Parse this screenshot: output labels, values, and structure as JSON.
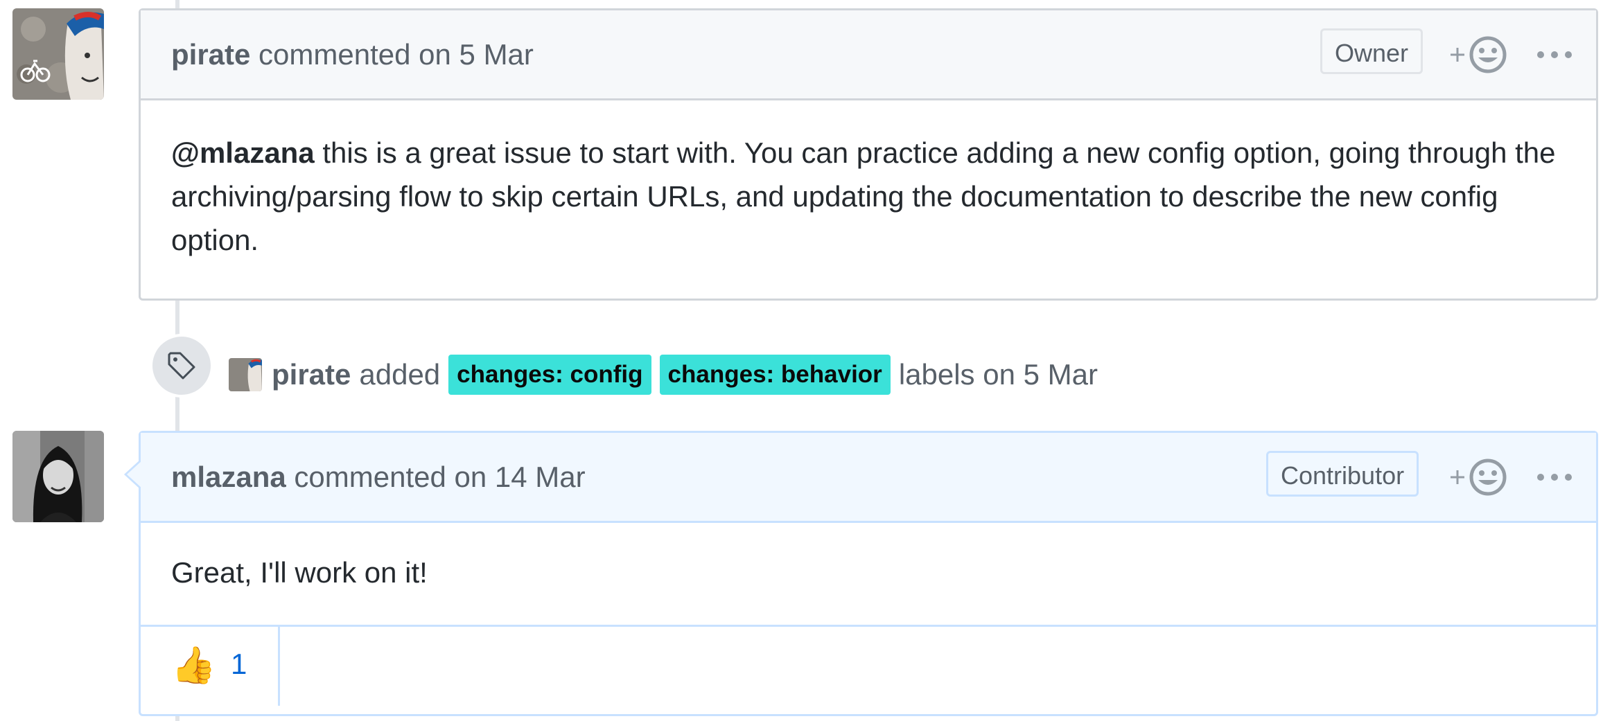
{
  "comments": [
    {
      "author": "pirate",
      "action_text": "commented on 5 Mar",
      "role": "Owner",
      "mention": "@mlazana",
      "body": "this is a great issue to start with. You can practice adding a new config option, going through the archiving/parsing flow to skip certain URLs, and updating the documentation to describe the new config option."
    },
    {
      "author": "mlazana",
      "action_text": "commented on 14 Mar",
      "role": "Contributor",
      "body": "Great, I'll work on it!",
      "reactions": [
        {
          "emoji": "👍",
          "count": "1"
        }
      ]
    }
  ],
  "event": {
    "author": "pirate",
    "verb": "added",
    "labels": [
      "changes: config",
      "changes: behavior"
    ],
    "suffix": "labels on 5 Mar"
  },
  "icons": {
    "add_reaction": "smiley-plus-icon",
    "more": "kebab-horizontal-icon",
    "event": "tag-icon"
  },
  "colors": {
    "label_bg": "#3be1d9",
    "highlight_header": "#f1f8ff",
    "link": "#0366d6"
  }
}
